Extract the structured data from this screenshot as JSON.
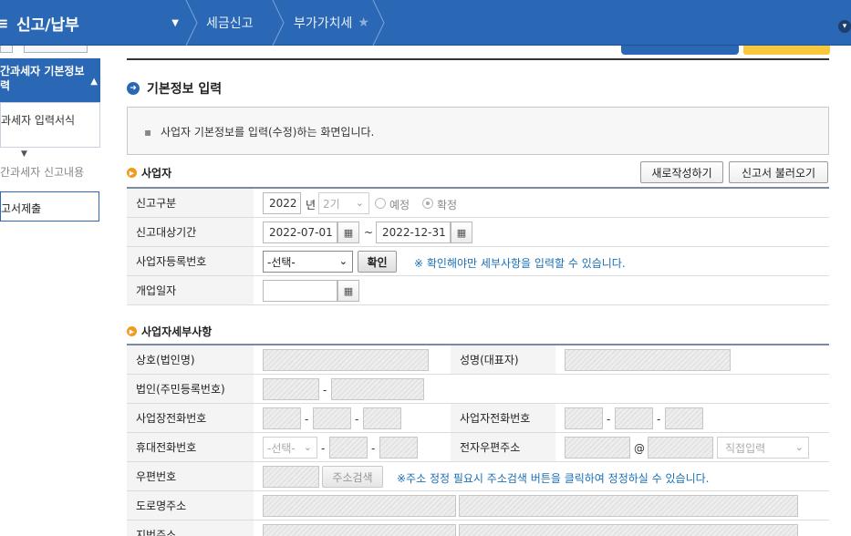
{
  "topbar": {
    "title": "신고/납부",
    "breadcrumb": [
      "세금신고",
      "부가가치세"
    ]
  },
  "sidebar": {
    "active_item": "간이과세자 기본정보 입력",
    "active_line1": "간과세자 기본정보",
    "active_line2": "력",
    "sub_item": "과세자 입력서식",
    "gray_item": "간과세자 신고내용",
    "box_item": "고서제출"
  },
  "section": {
    "title": "기본정보 입력",
    "info": "사업자 기본정보를 입력(수정)하는 화면입니다."
  },
  "business": {
    "title": "사업자",
    "new_button": "새로작성하기",
    "load_button": "신고서 불러오기",
    "rows": {
      "report_type": {
        "label": "신고구분",
        "year": "2022",
        "year_suffix": "년",
        "period": "2기",
        "option_planned": "예정",
        "option_final": "확정",
        "selected": "확정"
      },
      "report_period": {
        "label": "신고대상기간",
        "start": "2022-07-01",
        "tilde": "~",
        "end": "2022-12-31"
      },
      "reg_number": {
        "label": "사업자등록번호",
        "select_value": "-선택-",
        "confirm_button": "확인",
        "note": "※ 확인해야만 세부사항을 입력할 수 있습니다."
      },
      "open_date": {
        "label": "개업일자",
        "value": ""
      }
    }
  },
  "details": {
    "title": "사업자세부사항",
    "rows": {
      "company_name": "상호(법인명)",
      "rep_name": "성명(대표자)",
      "corp_number": "법인(주민등록번호)",
      "biz_phone": "사업장전화번호",
      "biz_owner_phone": "사업자전화번호",
      "mobile": "휴대전화번호",
      "mobile_select": "-선택-",
      "email": "전자우편주소",
      "email_at": "@",
      "email_domain_select": "직접입력",
      "zip": "우편번호",
      "zip_button": "주소검색",
      "zip_note": "※주소 정정 필요시 주소검색 버튼을 클릭하여 정정하실 수 있습니다.",
      "road_addr": "도로명주소",
      "lot_addr": "지번주소"
    },
    "dash": "-"
  },
  "colors": {
    "brand_blue": "#2a67b4",
    "note_blue": "#1b6fb5",
    "orange": "#f09b1d",
    "yellow": "#f8c83c"
  }
}
